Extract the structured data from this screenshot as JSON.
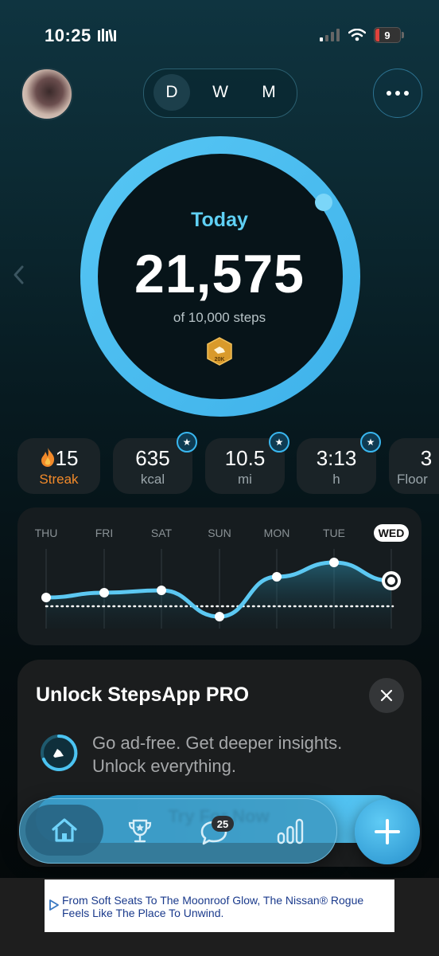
{
  "status_bar": {
    "time": "10:25",
    "battery_level": "9"
  },
  "period_selector": {
    "options": [
      "D",
      "W",
      "M"
    ],
    "selected": "D"
  },
  "summary": {
    "label": "Today",
    "steps": "21,575",
    "goal_text": "of 10,000 steps",
    "achievement_badge": "20K",
    "goal_progress": 2.1575
  },
  "stats": [
    {
      "value": "15",
      "label": "Streak",
      "icon": "flame-icon"
    },
    {
      "value": "635",
      "label": "kcal",
      "icon": "star-badge"
    },
    {
      "value": "10.5",
      "label": "mi",
      "icon": "star-badge"
    },
    {
      "value": "3:13",
      "label": "h",
      "icon": "star-badge"
    },
    {
      "value": "3",
      "label": "Floor",
      "icon": ""
    }
  ],
  "week_chart": {
    "days": [
      "THU",
      "FRI",
      "SAT",
      "SUN",
      "MON",
      "TUE",
      "WED"
    ],
    "selected_day": "WED"
  },
  "promo": {
    "title": "Unlock StepsApp PRO",
    "text": "Go ad-free. Get deeper insights. Unlock everything.",
    "cta": "Try For Now"
  },
  "tabbar": {
    "chat_badge": "25",
    "items": [
      "home-icon",
      "trophy-icon",
      "chat-icon",
      "stats-icon"
    ]
  },
  "ad": {
    "text": "From Soft Seats To The Moonroof Glow, The Nissan® Rogue Feels Like The Place To Unwind."
  },
  "colors": {
    "accent": "#4cc4f2",
    "streak": "#f28a2a",
    "card": "#1a2327"
  }
}
